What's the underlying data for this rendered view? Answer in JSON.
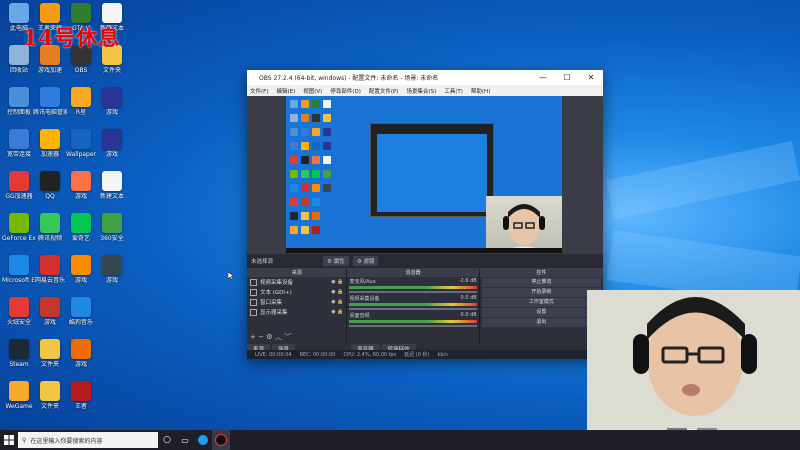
{
  "desktop": {
    "overlay_text": "14号休息",
    "icons": [
      {
        "label": "此电脑",
        "color": "#6aa7e8",
        "col": 0,
        "row": 0
      },
      {
        "label": "回收站",
        "color": "#8fb3d9",
        "col": 0,
        "row": 1
      },
      {
        "label": "控制面板",
        "color": "#4a90d9",
        "col": 0,
        "row": 2
      },
      {
        "label": "宽带连接",
        "color": "#3a7bd5",
        "col": 0,
        "row": 3
      },
      {
        "label": "GG加速器",
        "color": "#e53935",
        "col": 0,
        "row": 4
      },
      {
        "label": "GeForce Experience",
        "color": "#76b900",
        "col": 0,
        "row": 5
      },
      {
        "label": "Microsoft Edge",
        "color": "#1e88e5",
        "col": 0,
        "row": 6
      },
      {
        "label": "火绒安全",
        "color": "#e53935",
        "col": 0,
        "row": 7
      },
      {
        "label": "Steam",
        "color": "#1b2838",
        "col": 0,
        "row": 8
      },
      {
        "label": "WeGame",
        "color": "#f7a928",
        "col": 0,
        "row": 9
      },
      {
        "label": "王者荣耀",
        "color": "#f39c12",
        "col": 1,
        "row": 0
      },
      {
        "label": "游戏加速",
        "color": "#e67e22",
        "col": 1,
        "row": 1
      },
      {
        "label": "腾讯电脑管家",
        "color": "#2f7de1",
        "col": 1,
        "row": 2
      },
      {
        "label": "加速器",
        "color": "#ffb300",
        "col": 1,
        "row": 3
      },
      {
        "label": "QQ",
        "color": "#222222",
        "col": 1,
        "row": 4
      },
      {
        "label": "腾讯视频",
        "color": "#34c759",
        "col": 1,
        "row": 5
      },
      {
        "label": "网易云音乐",
        "color": "#d32f2f",
        "col": 1,
        "row": 6
      },
      {
        "label": "游戏",
        "color": "#c0392b",
        "col": 1,
        "row": 7
      },
      {
        "label": "文件夹",
        "color": "#f4c542",
        "col": 1,
        "row": 8
      },
      {
        "label": "文件夹",
        "color": "#f4c542",
        "col": 1,
        "row": 9
      },
      {
        "label": "GTA V",
        "color": "#2e7d32",
        "col": 2,
        "row": 0
      },
      {
        "label": "OBS",
        "color": "#333333",
        "col": 2,
        "row": 1
      },
      {
        "label": "R星",
        "color": "#f9a825",
        "col": 2,
        "row": 2
      },
      {
        "label": "Wallpaper",
        "color": "#1565c0",
        "col": 2,
        "row": 3
      },
      {
        "label": "游戏",
        "color": "#ff7043",
        "col": 2,
        "row": 4
      },
      {
        "label": "爱奇艺",
        "color": "#00c853",
        "col": 2,
        "row": 5
      },
      {
        "label": "游戏",
        "color": "#fb8c00",
        "col": 2,
        "row": 6
      },
      {
        "label": "酷狗音乐",
        "color": "#1e88e5",
        "col": 2,
        "row": 7
      },
      {
        "label": "游戏",
        "color": "#ef6c00",
        "col": 2,
        "row": 8
      },
      {
        "label": "王者",
        "color": "#b71c1c",
        "col": 2,
        "row": 9
      },
      {
        "label": "新建文本",
        "color": "#f5f5f5",
        "col": 3,
        "row": 0
      },
      {
        "label": "文件夹",
        "color": "#f4c542",
        "col": 3,
        "row": 1
      },
      {
        "label": "游戏",
        "color": "#283593",
        "col": 3,
        "row": 2
      },
      {
        "label": "游戏",
        "color": "#283593",
        "col": 3,
        "row": 3
      },
      {
        "label": "新建文本",
        "color": "#f5f5f5",
        "col": 3,
        "row": 4
      },
      {
        "label": "360安全",
        "color": "#43a047",
        "col": 3,
        "row": 5
      },
      {
        "label": "游戏",
        "color": "#37474f",
        "col": 3,
        "row": 6
      }
    ]
  },
  "obs": {
    "title": "OBS 27.2.4 (64-bit, windows) - 配置文件: 未命名 - 场景: 未命名",
    "menu": [
      "文件(F)",
      "编辑(E)",
      "视图(V)",
      "停靠部件(D)",
      "配置文件(P)",
      "场景集合(S)",
      "工具(T)",
      "帮助(H)"
    ],
    "toolbar_label": "未选择源",
    "toolbar_props": "属性",
    "toolbar_filters": "滤镜",
    "sources_header": "来源",
    "sources": [
      "视频采集设备",
      "文本 (GDI+)",
      "窗口采集",
      "显示器采集"
    ],
    "mixer_header": "混音器",
    "mixer": [
      {
        "name": "麦克风/Aux",
        "db": "-2.6 dB"
      },
      {
        "name": "视频采集设备",
        "db": "0.0 dB"
      },
      {
        "name": "桌面音频",
        "db": "0.0 dB"
      }
    ],
    "controls_header": "控件",
    "controls": [
      "停止推流",
      "开始录制",
      "工作室模式",
      "设置",
      "退出"
    ],
    "tabs": [
      "来源",
      "场景"
    ],
    "mixer_tabs": [
      "混音器",
      "转场特效"
    ],
    "status": [
      "LIVE: 00:00:04",
      "REC: 00:00:00",
      "CPU: 2.4%, 60.00 fps",
      "延迟 (0 秒)",
      "kb/s"
    ]
  },
  "taskbar": {
    "search_placeholder": "在这里输入你要搜索的内容"
  }
}
